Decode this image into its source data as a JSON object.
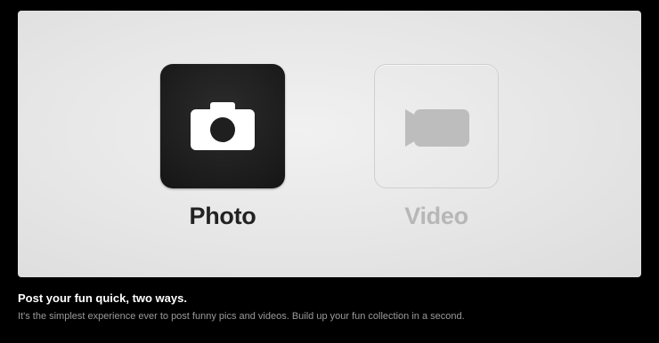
{
  "options": [
    {
      "label": "Photo",
      "icon": "camera-icon",
      "state": "selected"
    },
    {
      "label": "Video",
      "icon": "video-camera-icon",
      "state": "unselected"
    }
  ],
  "footer": {
    "headline": "Post your fun quick, two ways.",
    "description": "It's the simplest experience ever to post funny pics and videos. Build up your fun collection in a second."
  },
  "colors": {
    "background": "#000000",
    "panel": "#e8e8e8",
    "active_tile": "#1f1f1f",
    "active_label": "#222222",
    "inactive_label": "#b7b7b7",
    "inactive_icon": "#bdbdbd"
  }
}
